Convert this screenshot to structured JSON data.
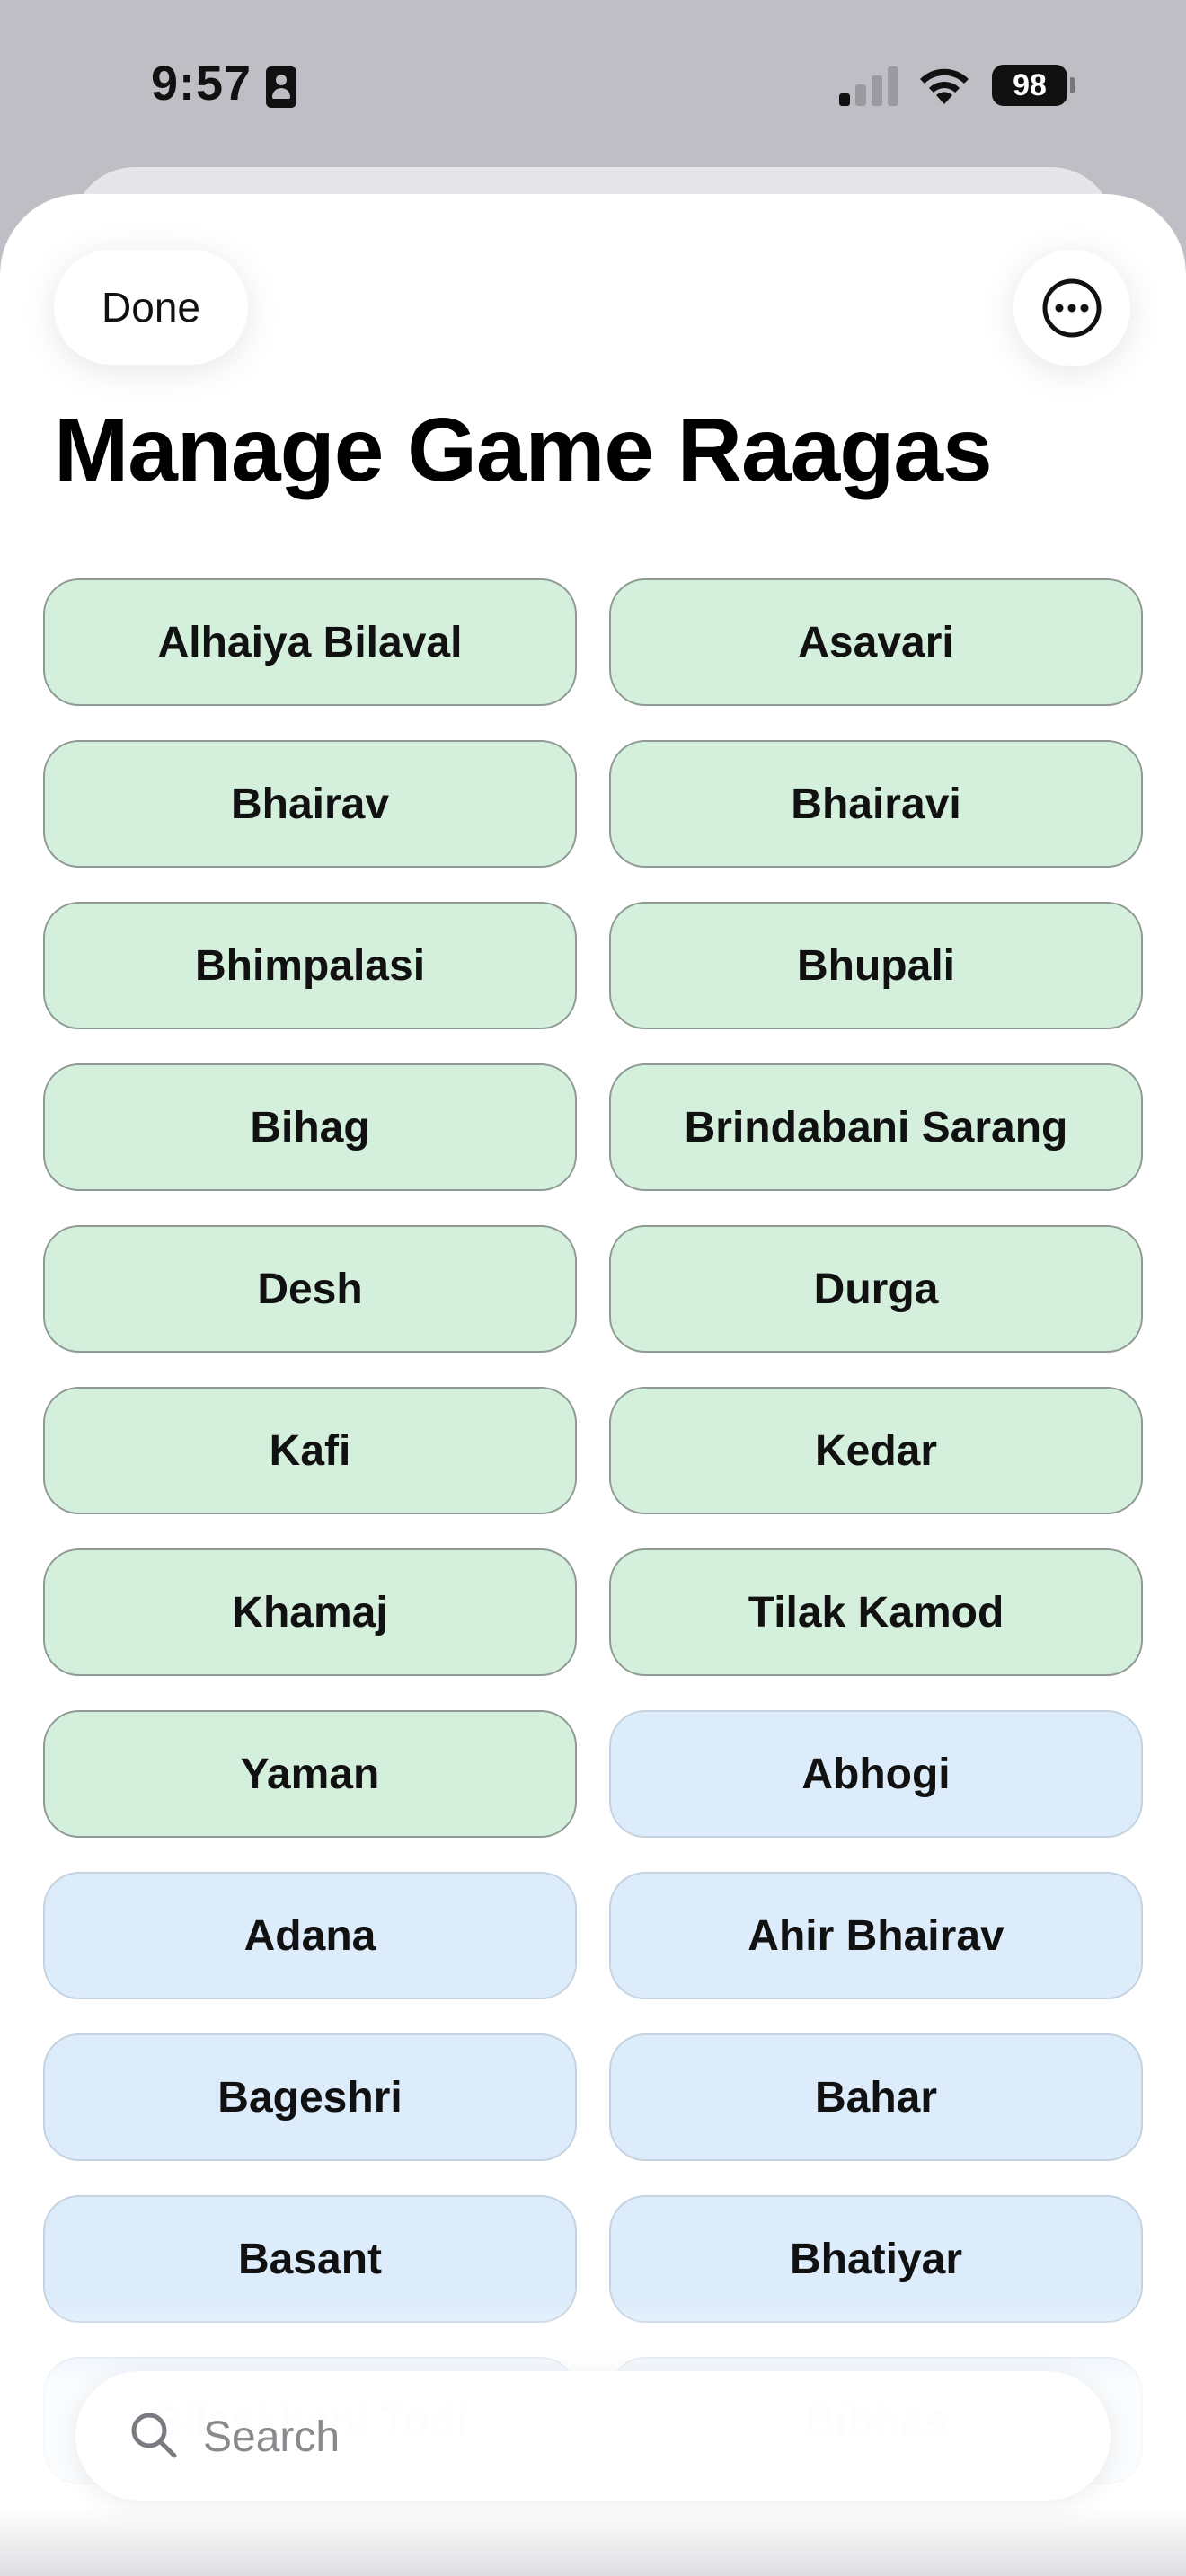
{
  "status_bar": {
    "time": "9:57",
    "battery": "98",
    "focus_icon": "person-card-icon",
    "signal_icon": "cellular-signal-icon",
    "wifi_icon": "wifi-icon"
  },
  "header": {
    "done_label": "Done",
    "more_icon": "ellipsis-circle-icon",
    "title": "Manage Game Raagas"
  },
  "colors": {
    "selected_fill": "#d4f0dc",
    "unselected_fill": "#ddecfb"
  },
  "raagas": [
    {
      "name": "Alhaiya Bilaval",
      "selected": true
    },
    {
      "name": "Asavari",
      "selected": true
    },
    {
      "name": "Bhairav",
      "selected": true
    },
    {
      "name": "Bhairavi",
      "selected": true
    },
    {
      "name": "Bhimpalasi",
      "selected": true
    },
    {
      "name": "Bhupali",
      "selected": true
    },
    {
      "name": "Bihag",
      "selected": true
    },
    {
      "name": "Brindabani Sarang",
      "selected": true
    },
    {
      "name": "Desh",
      "selected": true
    },
    {
      "name": "Durga",
      "selected": true
    },
    {
      "name": "Kafi",
      "selected": true
    },
    {
      "name": "Kedar",
      "selected": true
    },
    {
      "name": "Khamaj",
      "selected": true
    },
    {
      "name": "Tilak Kamod",
      "selected": true
    },
    {
      "name": "Yaman",
      "selected": true
    },
    {
      "name": "Abhogi",
      "selected": false
    },
    {
      "name": "Adana",
      "selected": false
    },
    {
      "name": "Ahir Bhairav",
      "selected": false
    },
    {
      "name": "Bageshri",
      "selected": false
    },
    {
      "name": "Bahar",
      "selected": false
    },
    {
      "name": "Basant",
      "selected": false
    },
    {
      "name": "Bhatiyar",
      "selected": false
    },
    {
      "name": "Bilaskhani Todi",
      "selected": false
    },
    {
      "name": "Bibhas",
      "selected": false
    }
  ],
  "search": {
    "placeholder": "Search",
    "value": ""
  }
}
